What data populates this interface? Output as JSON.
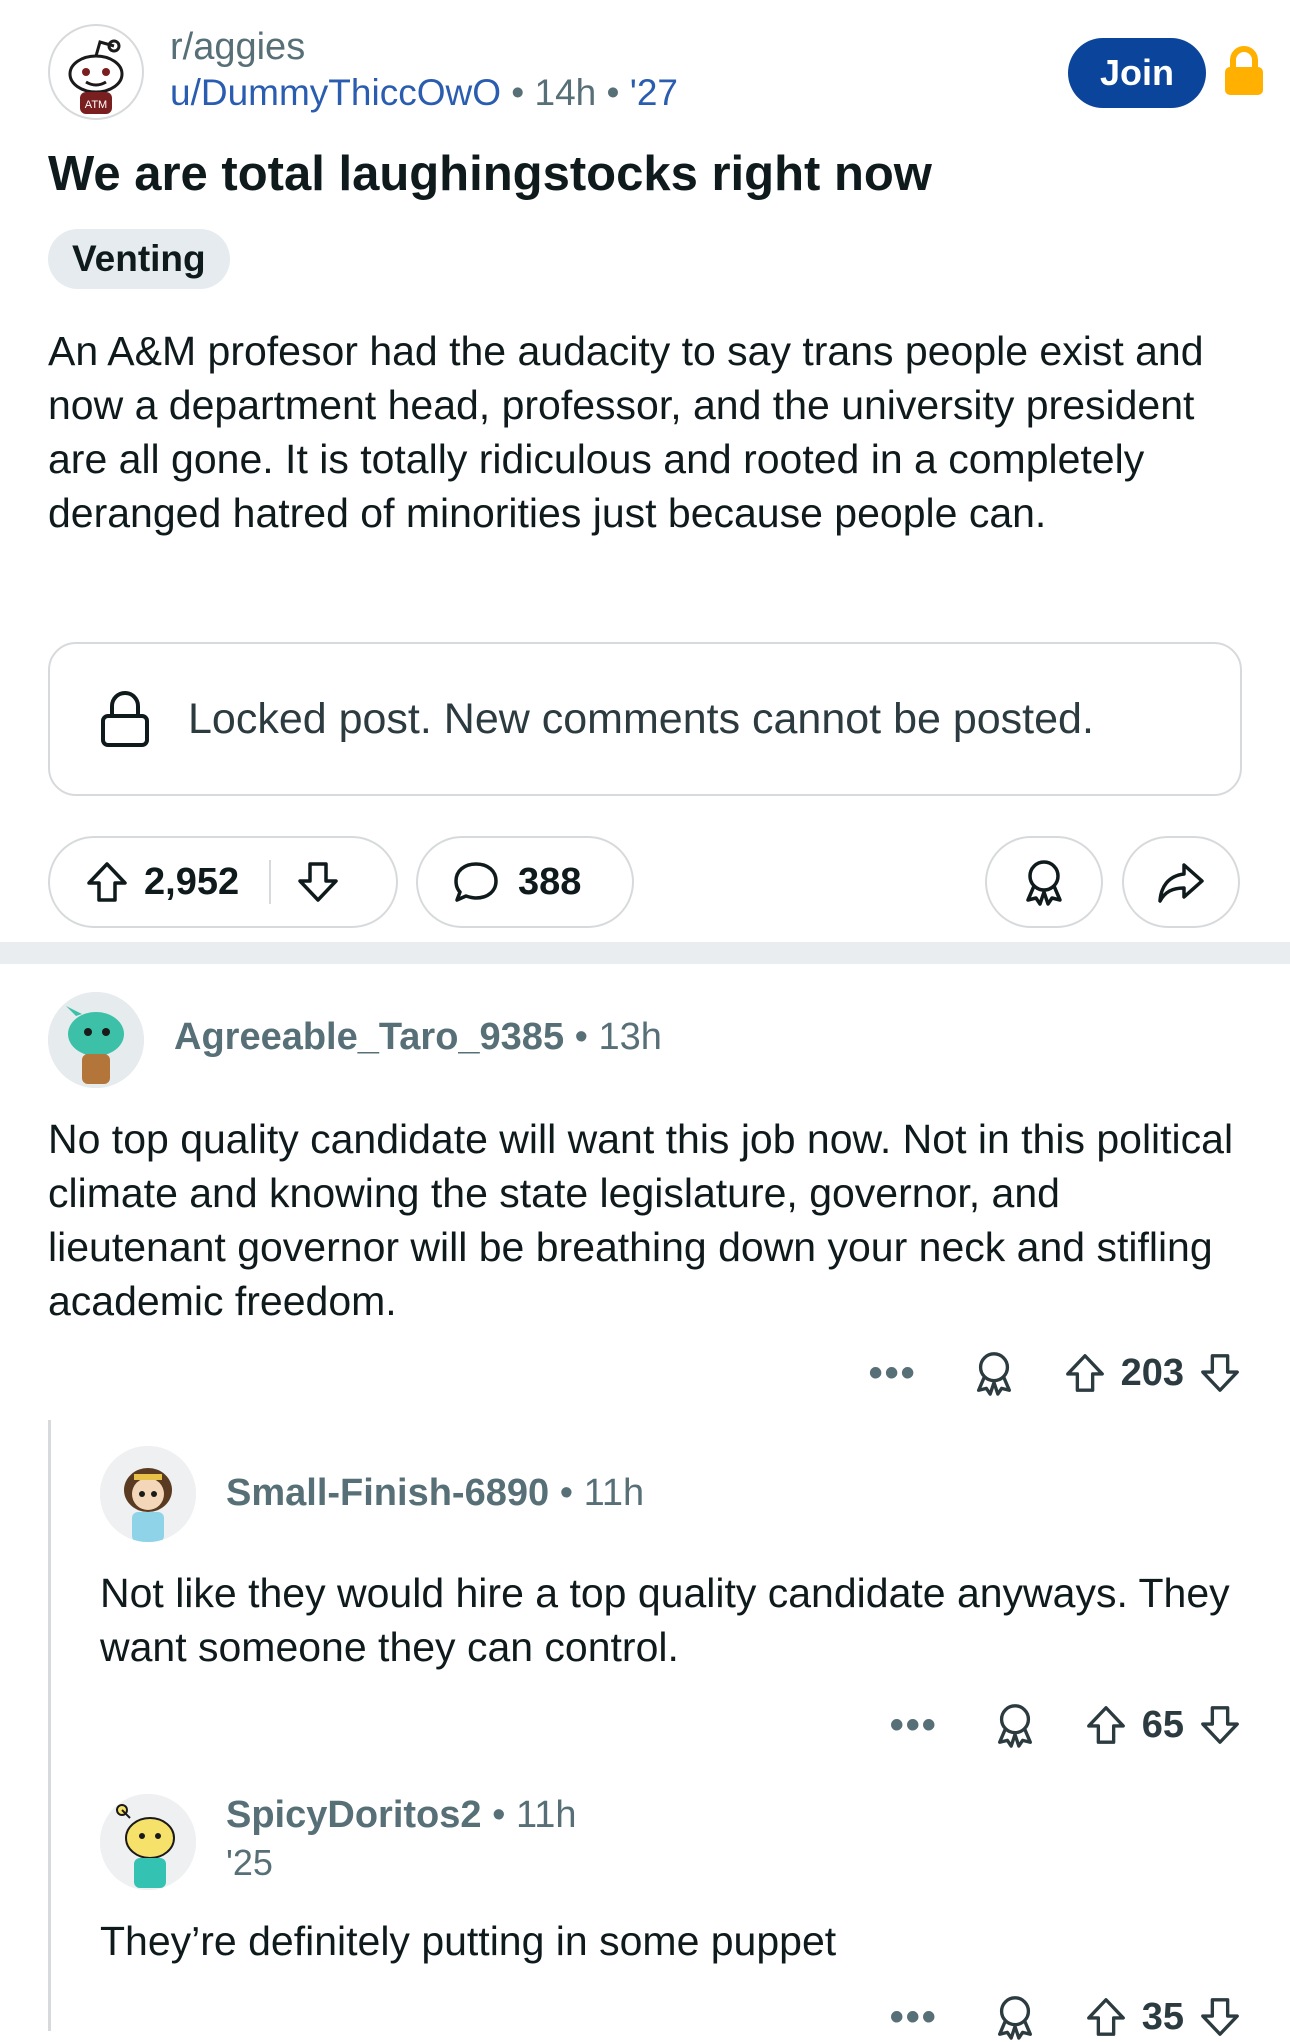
{
  "post": {
    "subreddit": "r/aggies",
    "author": "u/DummyThiccOwO",
    "separator": "•",
    "age": "14h",
    "user_flair": "'27",
    "join_label": "Join",
    "title": "We are total laughingstocks right now",
    "flair": "Venting",
    "body": "An A&M profesor had the audacity to say trans people exist and now a department head, professor, and the university president are all gone. It is totally ridiculous and rooted in a completely deranged hatred of minorities just because people can.",
    "locked_notice": "Locked post. New comments cannot be posted.",
    "upvotes": "2,952",
    "comments": "388"
  },
  "comments": [
    {
      "author": "Agreeable_Taro_9385",
      "age": "13h",
      "text": "No top quality candidate will want this job now.  Not in this political climate and knowing the state legislature, governor, and lieutenant governor will be breathing down your neck and stifling academic freedom.",
      "score": "203",
      "more": "•••"
    },
    {
      "author": "Small-Finish-6890",
      "age": "11h",
      "text": "Not like they would hire a top quality candidate anyways. They want someone they can control.",
      "score": "65",
      "more": "•••"
    },
    {
      "author": "SpicyDoritos2",
      "age": "11h",
      "flair": "'25",
      "text": "They’re definitely putting in some puppet",
      "score": "35",
      "more": "•••"
    }
  ],
  "colors": {
    "join": "#0a449b",
    "link": "#2a5db0",
    "lock": "#ffb000",
    "muted": "#576f76"
  },
  "icons": [
    "reddit-snoo-icon",
    "lock-icon",
    "upvote-icon",
    "downvote-icon",
    "comment-icon",
    "award-icon",
    "share-icon",
    "more-icon"
  ]
}
